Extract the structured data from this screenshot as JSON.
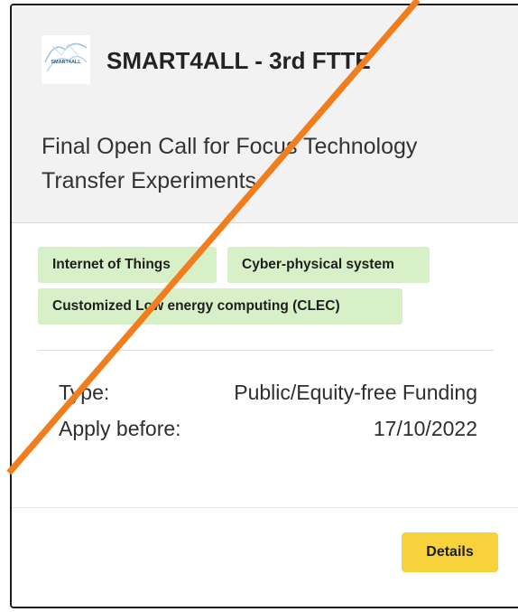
{
  "card": {
    "organization": "SMART4ALL - 3rd FTTE",
    "logo_text": "SMART4ALL",
    "title": "Final Open Call for Focus Technology Transfer Experiments",
    "tags": [
      "Internet of Things",
      "Cyber-physical system",
      "Customized Low energy computing (CLEC)"
    ],
    "info": [
      {
        "label": "Type:",
        "value": "Public/Equity-free Funding"
      },
      {
        "label": "Apply before:",
        "value": "17/10/2022"
      }
    ],
    "details_label": "Details"
  },
  "colors": {
    "tag_bg": "#d8f0c8",
    "button_bg": "#f7d23a",
    "strike_line": "#f07d1e",
    "header_bg": "#f2f2f2"
  }
}
